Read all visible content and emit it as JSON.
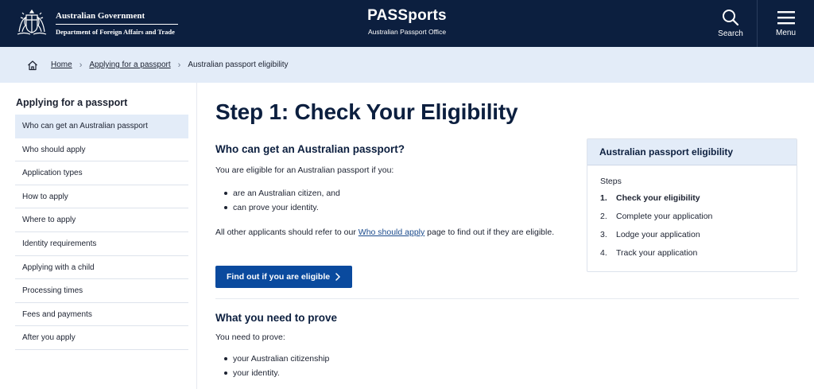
{
  "header": {
    "gov_name": "Australian Government",
    "gov_dept": "Department of Foreign Affairs and Trade",
    "brand_title": "PASSports",
    "brand_subtitle": "Australian Passport Office",
    "search_label": "Search",
    "menu_label": "Menu",
    "bg_color": "#0c1f3f"
  },
  "breadcrumb": {
    "items": [
      {
        "label": "Home"
      },
      {
        "label": "Applying for a passport"
      },
      {
        "label": "Australian passport eligibility"
      }
    ]
  },
  "sidebar": {
    "title": "Applying for a passport",
    "items": [
      {
        "label": "Who can get an Australian passport",
        "active": true
      },
      {
        "label": "Who should apply"
      },
      {
        "label": "Application types"
      },
      {
        "label": "How to apply"
      },
      {
        "label": "Where to apply"
      },
      {
        "label": "Identity requirements"
      },
      {
        "label": "Applying with a child"
      },
      {
        "label": "Processing times"
      },
      {
        "label": "Fees and payments"
      },
      {
        "label": "After you apply"
      }
    ]
  },
  "main": {
    "title": "Step 1: Check Your Eligibility",
    "section1": {
      "heading": "Who can get an Australian passport?",
      "intro": "You are eligible for an Australian passport if you:",
      "bullets": [
        "are an Australian citizen, and",
        "can prove your identity."
      ],
      "note_before": "All other applicants should refer to our ",
      "note_link": "Who should apply",
      "note_after": " page to find out if they are eligible.",
      "cta_label": "Find out if you are eligible"
    },
    "section2": {
      "heading": "What you need to prove",
      "intro": "You need to prove:",
      "bullets": [
        "your Australian citizenship",
        "your identity."
      ]
    }
  },
  "panel": {
    "title": "Australian passport eligibility",
    "steps_label": "Steps",
    "steps": [
      {
        "num": "1.",
        "label": "Check your eligibility",
        "current": true
      },
      {
        "num": "2.",
        "label": "Complete your application"
      },
      {
        "num": "3.",
        "label": "Lodge your application"
      },
      {
        "num": "4.",
        "label": "Track your application"
      }
    ]
  }
}
